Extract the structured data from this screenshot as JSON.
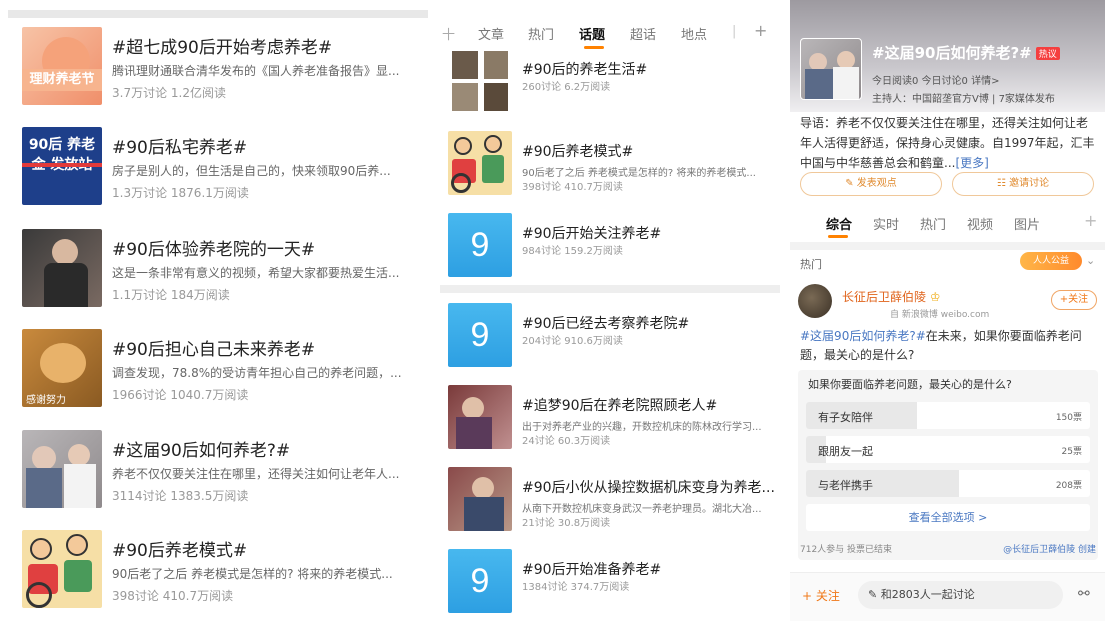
{
  "panel1": {
    "items": [
      {
        "title": "#超七成90后开始考虑养老#",
        "desc": "腾讯理财通联合清华发布的《国人养老准备报告》显...",
        "stats": "3.7万讨论 1.2亿阅读",
        "thumb_text": "理财养老节"
      },
      {
        "title": "#90后私宅养老#",
        "desc": "房子是别人的，但生活是自己的，快来领取90后养...",
        "stats": "1.3万讨论 1876.1万阅读",
        "thumb_text": "90后 养老金 发放站"
      },
      {
        "title": "#90后体验养老院的一天#",
        "desc": "这是一条非常有意义的视频，希望大家都要热爱生活...",
        "stats": "1.1万讨论 184万阅读",
        "thumb_text": ""
      },
      {
        "title": "#90后担心自己未来养老#",
        "desc": "调查发现，78.8%的受访青年担心自己的养老问题，...",
        "stats": "1966讨论 1040.7万阅读",
        "thumb_text": "感谢努力"
      },
      {
        "title": "#这届90后如何养老?#",
        "desc": "养老不仅仅要关注住在哪里，还得关注如何让老年人...",
        "stats": "3114讨论 1383.5万阅读",
        "thumb_text": ""
      },
      {
        "title": "#90后养老模式#",
        "desc": "90后老了之后 养老模式是怎样的? 将来的养老模式...",
        "stats": "398讨论 410.7万阅读",
        "thumb_text": ""
      }
    ]
  },
  "panel2": {
    "tabs": [
      "文章",
      "热门",
      "话题",
      "超话",
      "地点"
    ],
    "active_tab": "话题",
    "plus_icon": "plus-icon",
    "items": [
      {
        "title": "#90后的养老生活#",
        "desc": "",
        "stats": "260讨论 6.2万阅读",
        "thumb": "grid"
      },
      {
        "title": "#90后养老模式#",
        "desc": "90后老了之后 养老模式是怎样的? 将来的养老模式...",
        "stats": "398讨论 410.7万阅读",
        "thumb": "cartoon"
      },
      {
        "title": "#90后开始关注养老#",
        "desc": "",
        "stats": "984讨论 159.2万阅读",
        "thumb": "nine",
        "nine": "9"
      },
      {
        "title": "#90后已经去考察养老院#",
        "desc": "",
        "stats": "204讨论 910.6万阅读",
        "thumb": "nine",
        "nine": "9"
      },
      {
        "title": "#追梦90后在养老院照顾老人#",
        "desc": "出于对养老产业的兴趣，开数控机床的陈林改行学习...",
        "stats": "24讨论 60.3万阅读",
        "thumb": "photo"
      },
      {
        "title": "#90后小伙从操控数据机床变身为养老...",
        "desc": "从南下开数控机床变身武汉一养老护理员。湖北大冶...",
        "stats": "21讨论 30.8万阅读",
        "thumb": "photo"
      },
      {
        "title": "#90后开始准备养老#",
        "desc": "",
        "stats": "1384讨论 374.7万阅读",
        "thumb": "nine",
        "nine": "9"
      }
    ]
  },
  "panel3": {
    "title": "#这届90后如何养老?#",
    "hot_badge": "热议",
    "meta1": "今日阅读0  今日讨论0  详情>",
    "meta2": "主持人：中国韶垄官方V博 | 7家媒体发布",
    "intro": "导语：养老不仅仅要关注住在哪里，还得关注如何让老年人活得更舒适，保持身心灵健康。自1997年起，汇丰中国与中华慈善总会和鹤童...",
    "intro_more": "[更多]",
    "btn_post": "发表观点",
    "btn_invite": "邀请讨论",
    "tabs": [
      "综合",
      "实时",
      "热门",
      "视频",
      "图片"
    ],
    "active_tab": "综合",
    "hot_label": "热门",
    "hot_badge2": "人人公益",
    "user_name": "长征后卫薛伯陵",
    "user_source": "自 新浪微博 weibo.com",
    "follow_label": "+关注",
    "post_link": "#这届90后如何养老?#",
    "post_text": "在未来，如果你要面临养老问题，最关心的是什么?",
    "poll": {
      "question": "如果你要面临养老问题，最关心的是什么?",
      "options": [
        {
          "label": "有子女陪伴",
          "count": "150票",
          "share": 0.39
        },
        {
          "label": "跟朋友一起",
          "count": "25票",
          "share": 0.07
        },
        {
          "label": "与老伴携手",
          "count": "208票",
          "share": 0.54
        }
      ],
      "see_all": "查看全部选项 >",
      "participants": "712人参与  投票已结束",
      "creator": "@长征后卫薛伯陵 创建"
    },
    "bottom": {
      "follow": "+ 关注",
      "input": "和2803人一起讨论",
      "share_icon": "share-icon"
    }
  }
}
